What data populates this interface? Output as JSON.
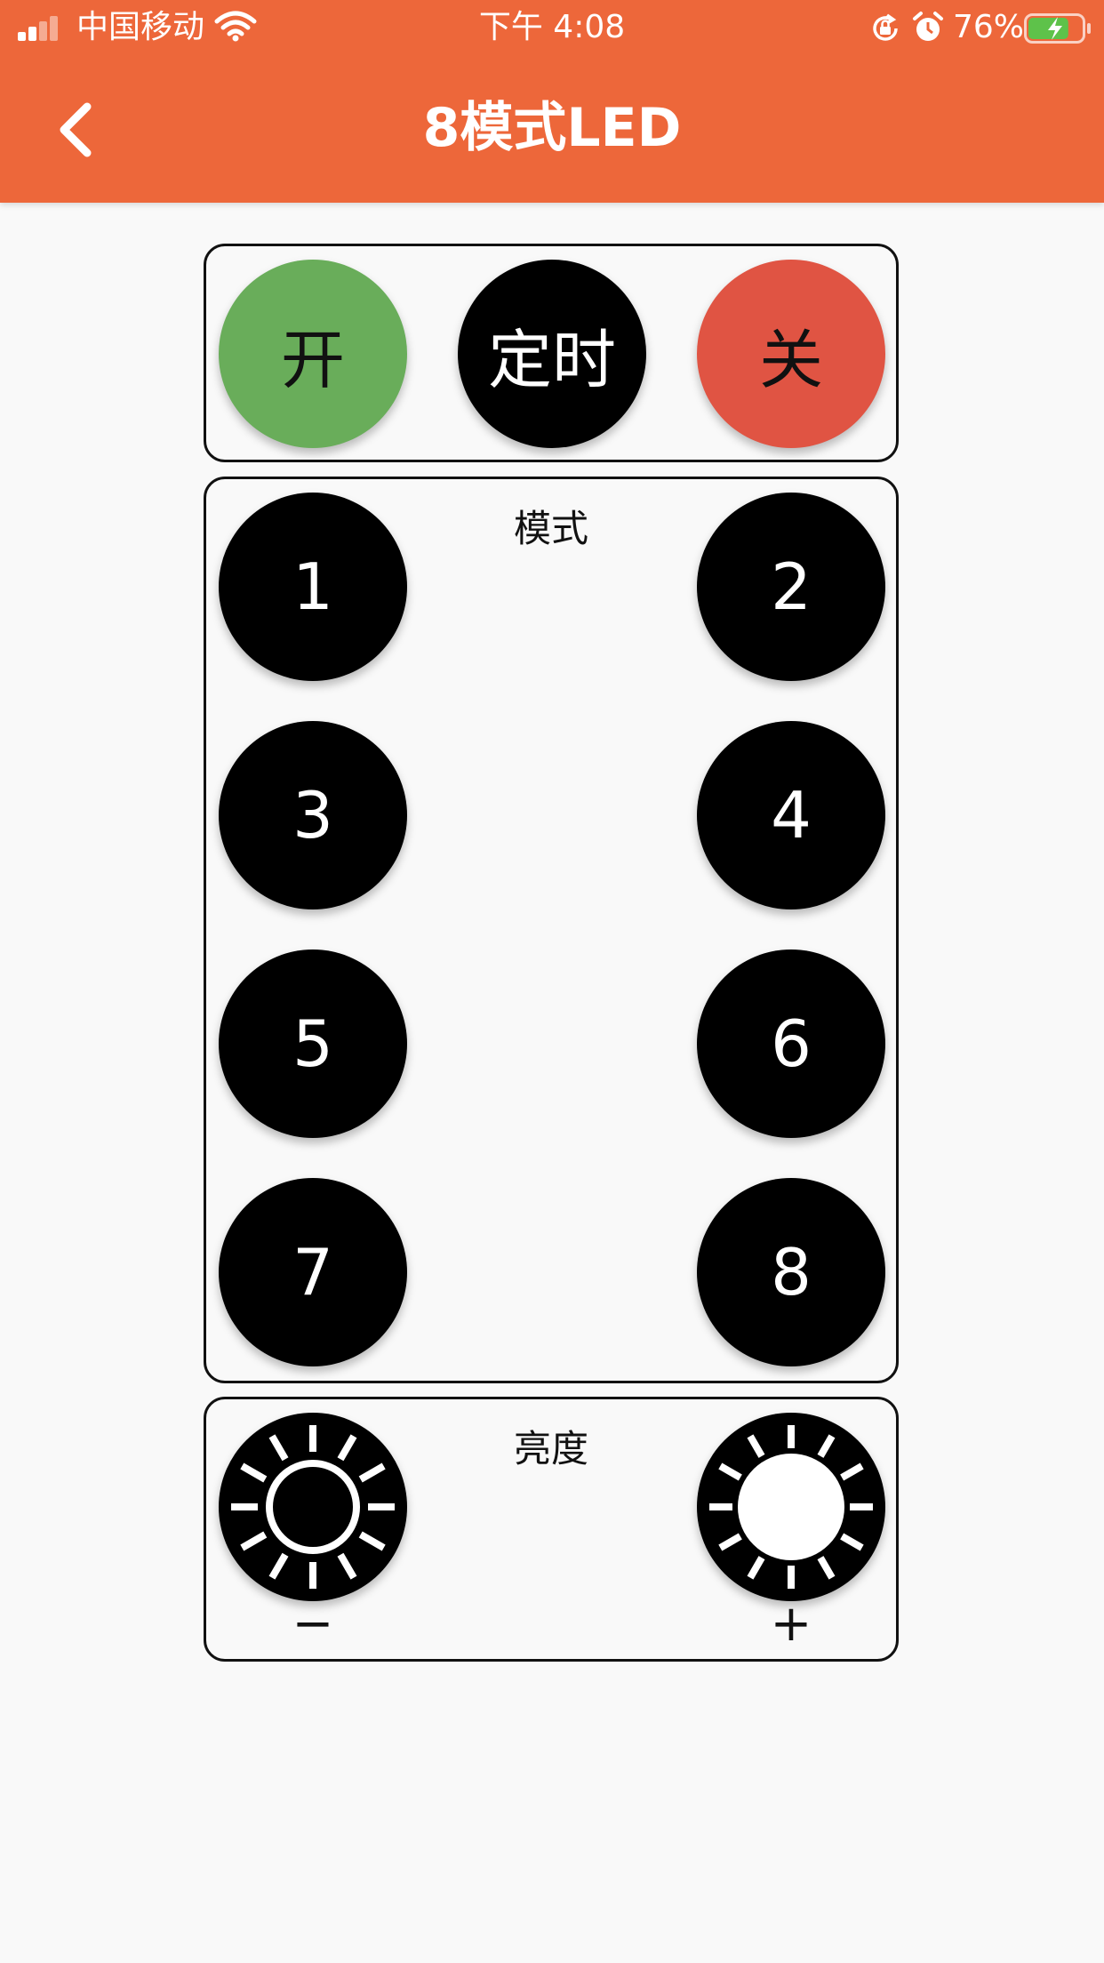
{
  "status_bar": {
    "carrier": "中国移动",
    "time": "下午 4:08",
    "battery": "76%",
    "battery_level": 0.76,
    "battery_color": "#5ec24a"
  },
  "nav": {
    "title": "8模式LED",
    "back_icon": "chevron-left-icon"
  },
  "power": {
    "on_label": "开",
    "timer_label": "定时",
    "off_label": "关",
    "on_color": "#69ad5a",
    "off_color": "#e05443"
  },
  "modes": {
    "label": "模式",
    "buttons": [
      "1",
      "2",
      "3",
      "4",
      "5",
      "6",
      "7",
      "8"
    ]
  },
  "brightness": {
    "label": "亮度",
    "decrease_icon": "sun-outline-icon",
    "increase_icon": "sun-filled-icon",
    "minus_label": "−",
    "plus_label": "+"
  },
  "colors": {
    "accent": "#ed673a",
    "background": "#f9f9f9"
  }
}
